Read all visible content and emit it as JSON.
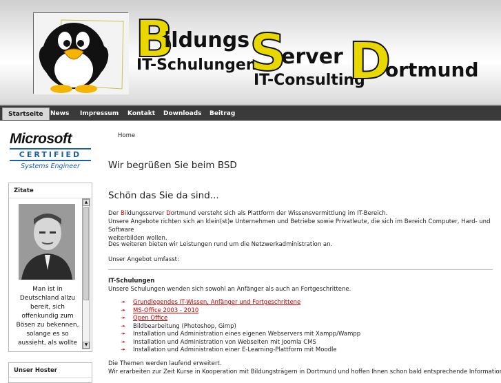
{
  "header": {
    "title_word1_initial": "B",
    "title_word1_rest": "ildungs",
    "title_word2_initial": "S",
    "title_word2_rest": "erver",
    "title_word3_initial": "D",
    "title_word3_rest": "ortmund",
    "subtitle_left": "IT-Schulungen",
    "subtitle_right": "IT-Consulting"
  },
  "nav": {
    "items": [
      {
        "label": "Startseite",
        "active": true
      },
      {
        "label": "News"
      },
      {
        "label": "Impressum"
      },
      {
        "label": "Kontakt"
      },
      {
        "label": "Downloads"
      },
      {
        "label": "Beitrag"
      }
    ]
  },
  "sidebar": {
    "ms_brand": "Microsoft",
    "ms_certified": "CERTIFIED",
    "ms_role": "Systems Engineer",
    "quotes_title": "Zitate",
    "quote_text": "Man ist in Deutschland allzu bereit, sich offenkundig zum Bösen zu bekennen, solange es so aussieht, als wollte",
    "hoster_title": "Unser Hoster"
  },
  "main": {
    "breadcrumb": "Home",
    "heading": "Wir begrüßen Sie beim BSD",
    "subheading": "Schön das Sie da sind...",
    "intro_der": "Der ",
    "intro_b": "B",
    "intro_ildungsserver": "ildungsserver ",
    "intro_d": "D",
    "intro_rest": "ortmund versteht sich als Plattform der Wissensvermittlung im IT-Bereich.",
    "intro_line2": "Unsere Angebote richten sich an klein(st)e Unternehmen und Betriebe sowie Privatleute, die sich im Bereich Computer, Hard- und Software",
    "intro_line3": "weiterbilden wollen.",
    "para2": "Des weiteren bieten wir Leistungen rund um die Netzwerkadministration an.",
    "para3": "Unser Angebot umfasst:",
    "section_title": "IT-Schulungen",
    "section_text": "Unsere Schulungen wenden sich sowohl an Anfänger als auch an Fortgeschrittene.",
    "list": [
      {
        "text": "Grundlegendes IT-Wissen, Anfänger und Fortgeschrittene",
        "link": true
      },
      {
        "text": "MS-Office 2003 - 2010",
        "link": true
      },
      {
        "text": "Open Office",
        "link": true
      },
      {
        "text": "Bildbearbeitung (Photoshop, Gimp)",
        "link": false
      },
      {
        "text": "Installation und Administration eines eigenen Webservers mit Xampp/Wampp",
        "link": false
      },
      {
        "text": "Installation und Administration von Webseiten mit Joomla CMS",
        "link": false
      },
      {
        "text": "Installation und Administration einer E-Learning-Plattform mit Moodle",
        "link": false
      }
    ],
    "footer_line1": "Die Themen werden laufend erweitert.",
    "footer_line2": "Wir erarbeiten zur Zeit Kurse in Kooperation mit Bildungsträgern in Dortmund und hoffen Ihnen schon bald entsprechende Informationen und"
  },
  "colors": {
    "accent_red": "#d00000",
    "nav_bg": "#3a3a3a",
    "title_yellow": "#e8d800",
    "ms_blue": "#1b5fa8"
  }
}
